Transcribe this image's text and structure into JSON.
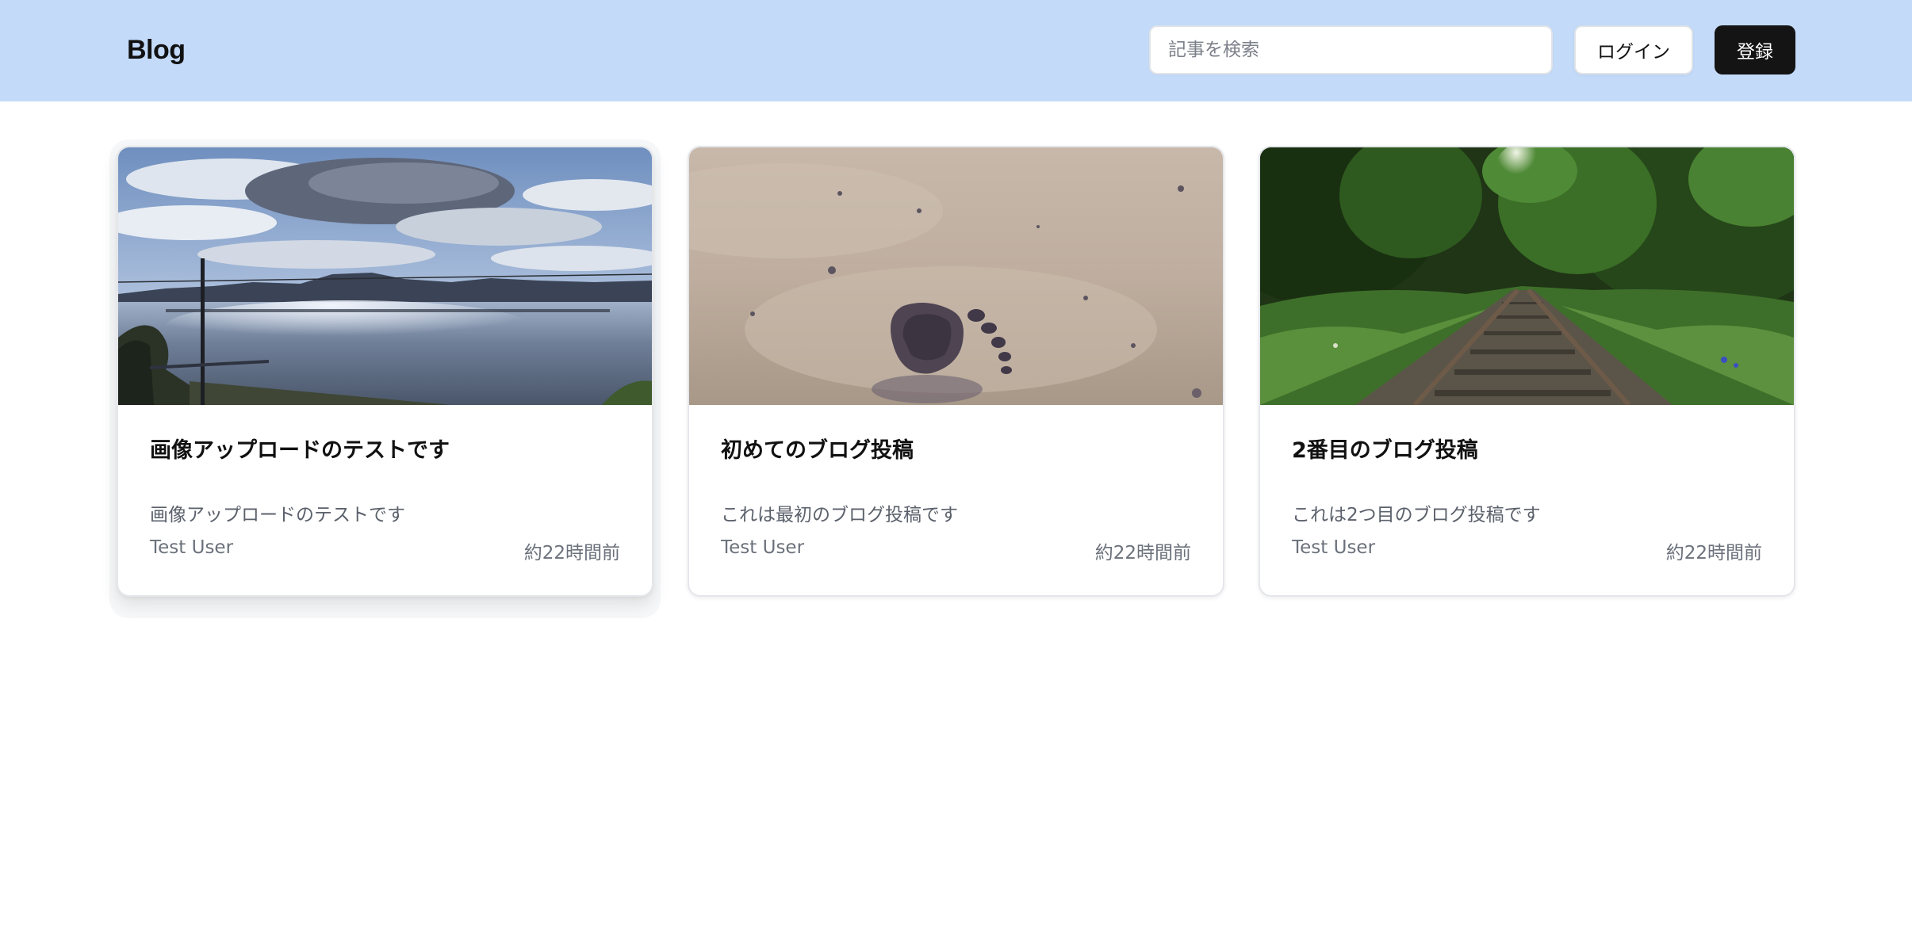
{
  "header": {
    "logo": "Blog",
    "search_placeholder": "記事を検索",
    "login_label": "ログイン",
    "register_label": "登録"
  },
  "posts": [
    {
      "title": "画像アップロードのテストです",
      "description": "画像アップロードのテストです",
      "author": "Test User",
      "time": "約22時間前",
      "image": "lake-landscape-photo"
    },
    {
      "title": "初めてのブログ投稿",
      "description": "これは最初のブログ投稿です",
      "author": "Test User",
      "time": "約22時間前",
      "image": "footprint-in-sand-photo"
    },
    {
      "title": "2番目のブログ投稿",
      "description": "これは2つ目のブログ投稿です",
      "author": "Test User",
      "time": "約22時間前",
      "image": "railway-tracks-forest-photo"
    }
  ],
  "colors": {
    "header_bg": "#c3daf9",
    "register_bg": "#141414",
    "muted_text": "#6b717b"
  }
}
